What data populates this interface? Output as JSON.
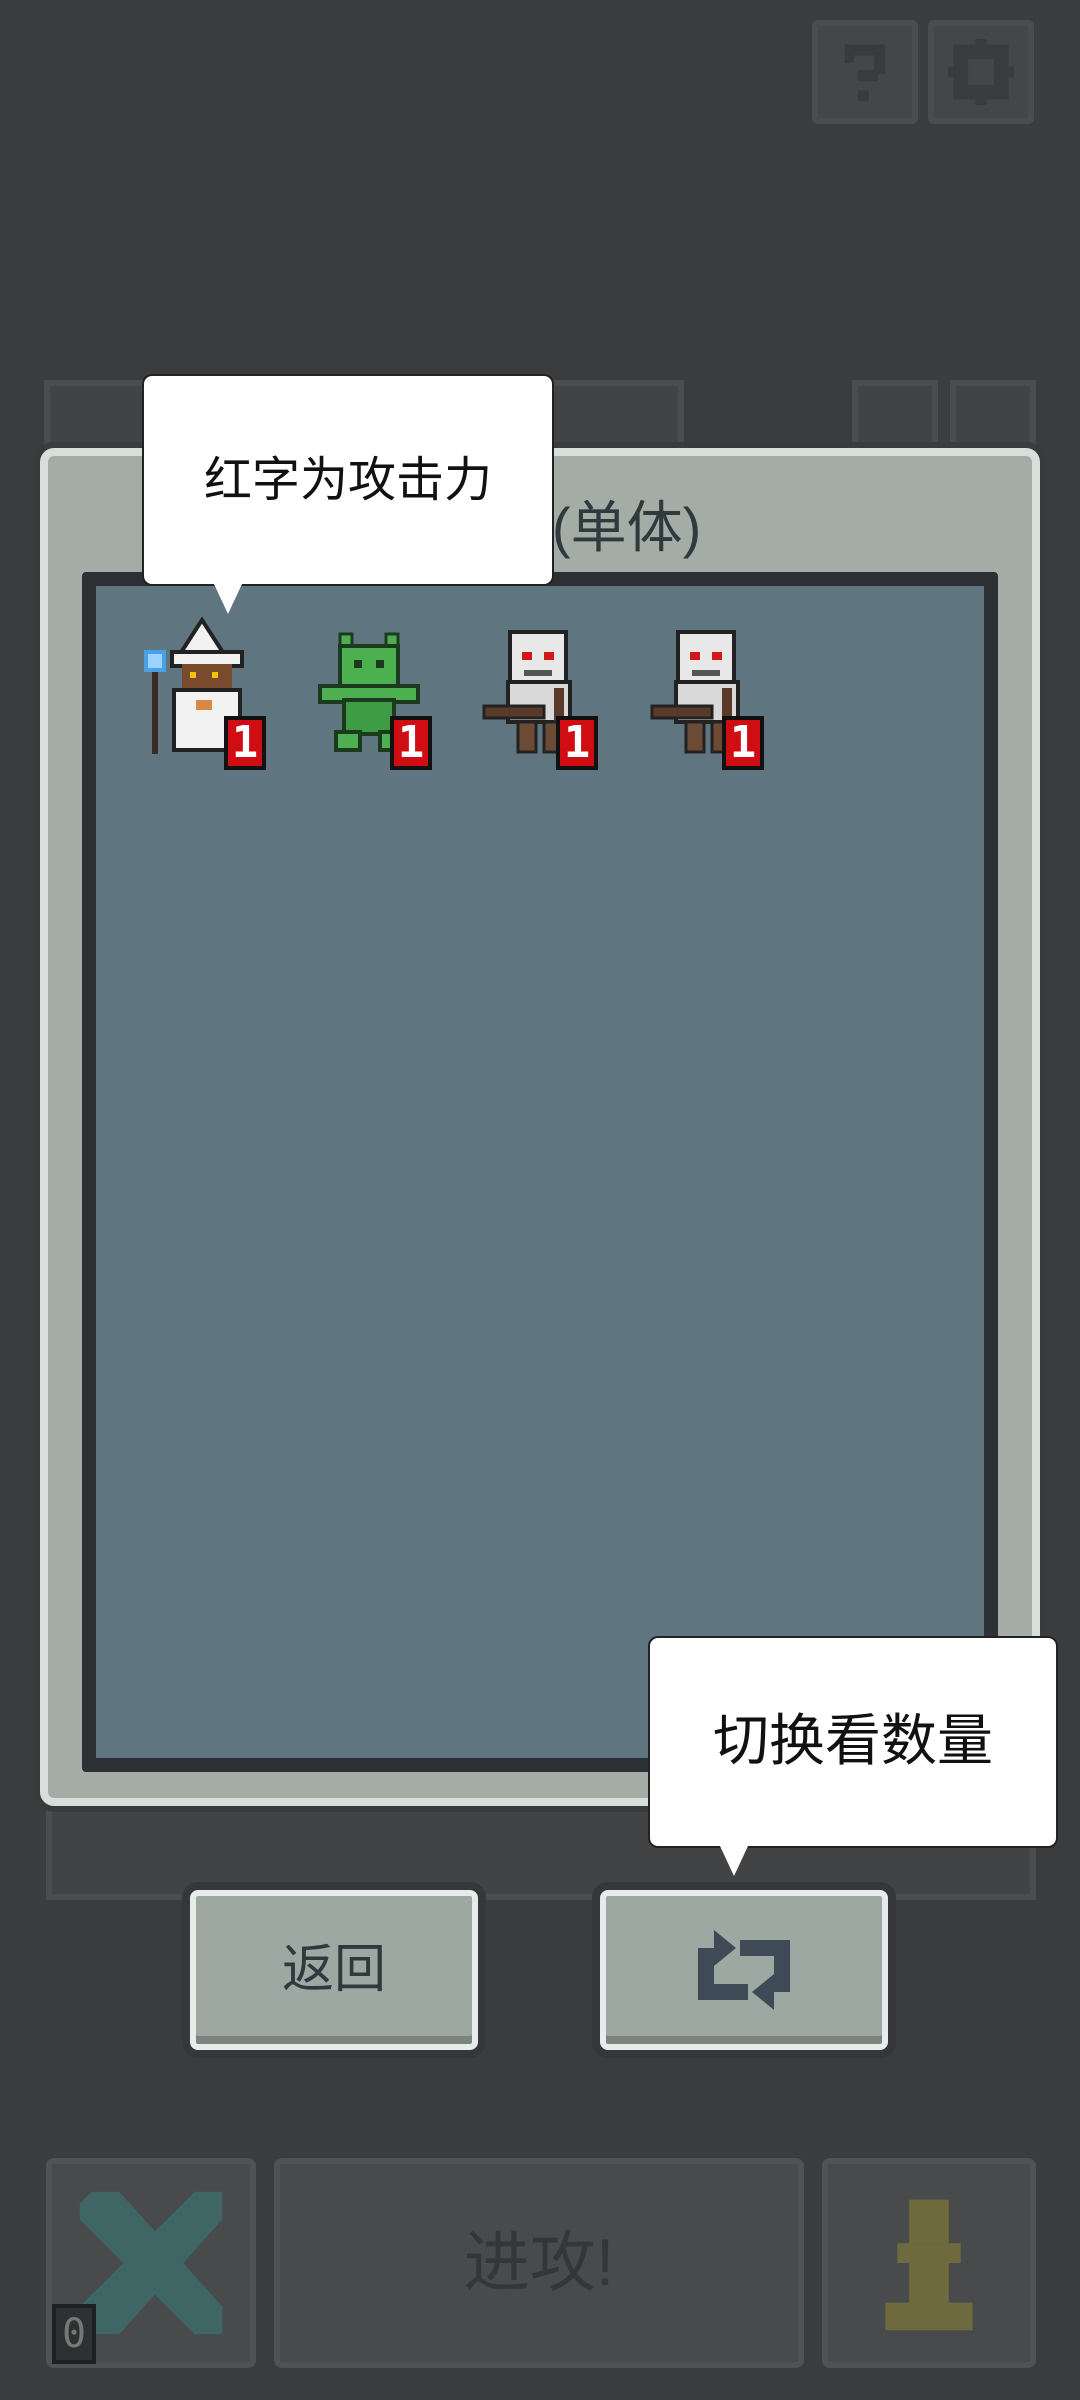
{
  "top_buttons": [
    {
      "icon": "help-icon"
    },
    {
      "icon": "settings-icon"
    }
  ],
  "dialog": {
    "title": "阵营(单体)",
    "units": [
      {
        "name": "white-wizard",
        "attack": "1"
      },
      {
        "name": "green-goblin",
        "attack": "1"
      },
      {
        "name": "skeleton-archer",
        "attack": "1"
      },
      {
        "name": "skeleton-archer",
        "attack": "1"
      }
    ],
    "back_label": "返回",
    "toggle_icon": "swap-arrows-icon"
  },
  "tooltips": {
    "attack_hint": "红字为攻击力",
    "toggle_hint": "切换看数量"
  },
  "bottom_bar": {
    "attack_label": "进攻!",
    "left_counter": "0"
  },
  "colors": {
    "background": "#3b3c3d",
    "dialog_frame": "#a3ada6",
    "inner_panel": "#5f7580",
    "attack_badge": "#d10d14"
  }
}
